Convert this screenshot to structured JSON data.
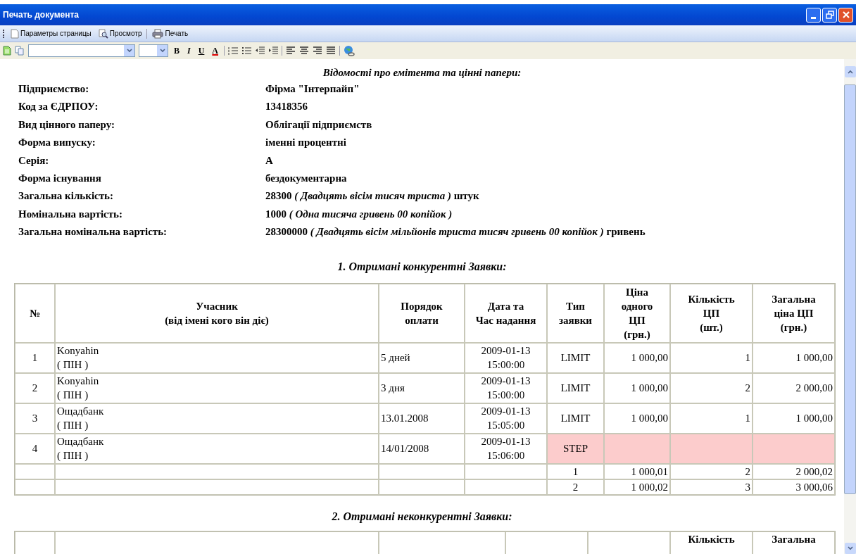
{
  "window": {
    "title": "Печать документа"
  },
  "toolbar": [
    {
      "label": "Параметры страницы",
      "kind": "page"
    },
    {
      "label": "Просмотр",
      "kind": "preview"
    },
    {
      "label": "Печать",
      "kind": "print"
    }
  ],
  "format_toolbar": {
    "text_buttons": [
      {
        "label": "B",
        "kind": "bold"
      },
      {
        "label": "I",
        "kind": "italic"
      },
      {
        "label": "U",
        "kind": "underline"
      },
      {
        "label": "A",
        "kind": "color"
      }
    ]
  },
  "document": {
    "heading": "Відомості про емітента та цінні папери:",
    "fields": [
      {
        "label": "Підприємство:",
        "value": "Фірма \"Інтерпайп\""
      },
      {
        "label": "Код за ЄДРПОУ:",
        "value": "13418356"
      },
      {
        "label": "Вид цінного паперу:",
        "value": "Облігації підприємств"
      },
      {
        "label": "Форма випуску:",
        "value": "іменні процентні"
      },
      {
        "label": "Серія:",
        "value": "А"
      },
      {
        "label": "Форма існування",
        "value": "бездокументарна"
      },
      {
        "label": "Загальна кількість:",
        "value": "28300  *( Двадцять вісім тисяч триста )*  штук"
      },
      {
        "label": "Номінальна вартість:",
        "value": "1000  *( Одна тисяча гривень 00 копійок )*"
      },
      {
        "label": "Загальна номінальна вартість:",
        "value": "28300000  *( Двадцять вісім мільйонів триста тисяч гривень 00 копійок )* гривень"
      }
    ],
    "section_1": {
      "heading": "1. Отримані конкурентні Заявки:",
      "columns": [
        "№",
        "Учасник\n(від імені кого він діє)",
        "Порядок\nоплати",
        "Дата та\nЧас надання",
        "Тип\nзаявки",
        "Ціна\nодного\nЦП\n(грн.)",
        "Кількість\nЦП\n(шт.)",
        "Загальна\nціна ЦП\n(грн.)"
      ],
      "rows": [
        {
          "highlighted": false,
          "cells": [
            "1",
            "Konyahin\n( ПІН )",
            "5 дней",
            "2009-01-13\n15:00:00",
            "LIMIT",
            "1 000,00",
            "1",
            "1 000,00"
          ]
        },
        {
          "highlighted": false,
          "cells": [
            "2",
            "Konyahin\n( ПІН )",
            "3 дня",
            "2009-01-13\n15:00:00",
            "LIMIT",
            "1 000,00",
            "2",
            "2 000,00"
          ]
        },
        {
          "highlighted": false,
          "cells": [
            "3",
            "Ощадбанк\n( ПІН )",
            "13.01.2008",
            "2009-01-13\n15:05:00",
            "LIMIT",
            "1 000,00",
            "1",
            "1 000,00"
          ]
        },
        {
          "highlighted": true,
          "cells": [
            "4",
            "Ощадбанк\n( ПІН )",
            "14/01/2008",
            "2009-01-13\n15:06:00",
            "STEP",
            "",
            "",
            ""
          ]
        },
        {
          "highlighted": false,
          "cells": [
            "",
            "",
            "",
            "",
            "1",
            "1 000,01",
            "2",
            "2 000,02"
          ]
        },
        {
          "highlighted": false,
          "cells": [
            "",
            "",
            "",
            "",
            "2",
            "1 000,02",
            "3",
            "3 000,06"
          ]
        }
      ]
    },
    "section_2": {
      "heading": "2. Отримані неконкурентні Заявки:",
      "columns": [
        "Кількість",
        "Загальна"
      ]
    }
  }
}
